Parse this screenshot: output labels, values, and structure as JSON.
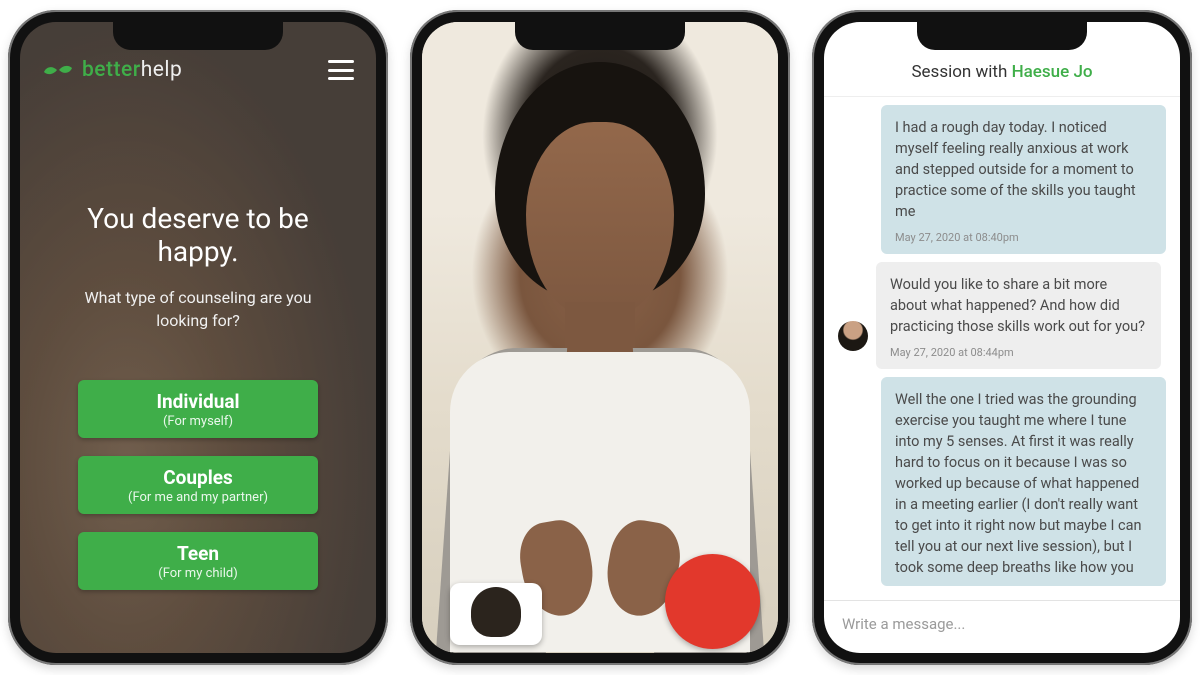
{
  "phone1": {
    "brand_better": "better",
    "brand_help": "help",
    "headline": "You deserve to be happy.",
    "subhead": "What type of counseling are you looking for?",
    "options": [
      {
        "title": "Individual",
        "sub": "(For myself)"
      },
      {
        "title": "Couples",
        "sub": "(For me and my partner)"
      },
      {
        "title": "Teen",
        "sub": "(For my child)"
      }
    ]
  },
  "phone3": {
    "header_prefix": "Session with ",
    "therapist_name": "Haesue Jo",
    "messages": [
      {
        "from": "me",
        "text": "I had a rough day today. I noticed myself feeling really anxious at work and stepped outside for a moment to practice some of the skills you taught me",
        "timestamp": "May 27, 2020 at 08:40pm"
      },
      {
        "from": "them",
        "text": "Would you like to share a bit more about what happened? And how did practicing those skills work out for you?",
        "timestamp": "May 27, 2020 at 08:44pm"
      },
      {
        "from": "me",
        "text": "Well the one I tried was the grounding exercise you taught me where I tune into my 5 senses. At first it was really hard to focus on it because I was so worked up because of what happened in a meeting earlier (I don't really want to get into it right now but maybe I can tell you at our next live session), but I took some deep breaths like how you",
        "timestamp": ""
      }
    ],
    "compose_placeholder": "Write a message..."
  }
}
